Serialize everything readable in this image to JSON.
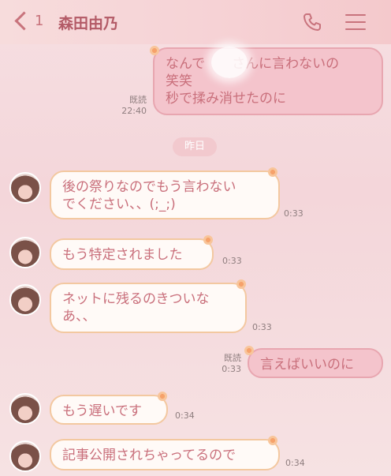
{
  "header": {
    "back_count": "1",
    "title": "森田由乃",
    "icons": [
      "chevron-left-icon",
      "phone-icon",
      "menu-icon"
    ]
  },
  "messages": {
    "m1": {
      "direction": "outgoing",
      "lines": [
        "なんで　　さんに言わないの",
        "笑笑",
        "秒で揉み消せたのに"
      ],
      "read": "既読",
      "time": "22:40"
    },
    "date_divider": "昨日",
    "m2": {
      "direction": "incoming",
      "lines": [
        "後の祭りなのでもう言わない",
        "でください、、(;_;)"
      ],
      "time": "0:33"
    },
    "m3": {
      "direction": "incoming",
      "lines": [
        "もう特定されました"
      ],
      "time": "0:33"
    },
    "m4": {
      "direction": "incoming",
      "lines": [
        "ネットに残るのきついな",
        "あ、、"
      ],
      "time": "0:33"
    },
    "m5": {
      "direction": "outgoing",
      "lines": [
        "言えばいいのに"
      ],
      "read": "既読",
      "time": "0:33"
    },
    "m6": {
      "direction": "incoming",
      "lines": [
        "もう遅いです"
      ],
      "time": "0:34"
    },
    "m7": {
      "direction": "incoming",
      "lines": [
        "記事公開されちゃってるので"
      ],
      "time": "0:34"
    }
  },
  "colors": {
    "bubble_in_bg": "#fffaf7",
    "bubble_out_bg": "#f4c4cc",
    "text": "#c96f7b",
    "accent": "#b35a66"
  }
}
